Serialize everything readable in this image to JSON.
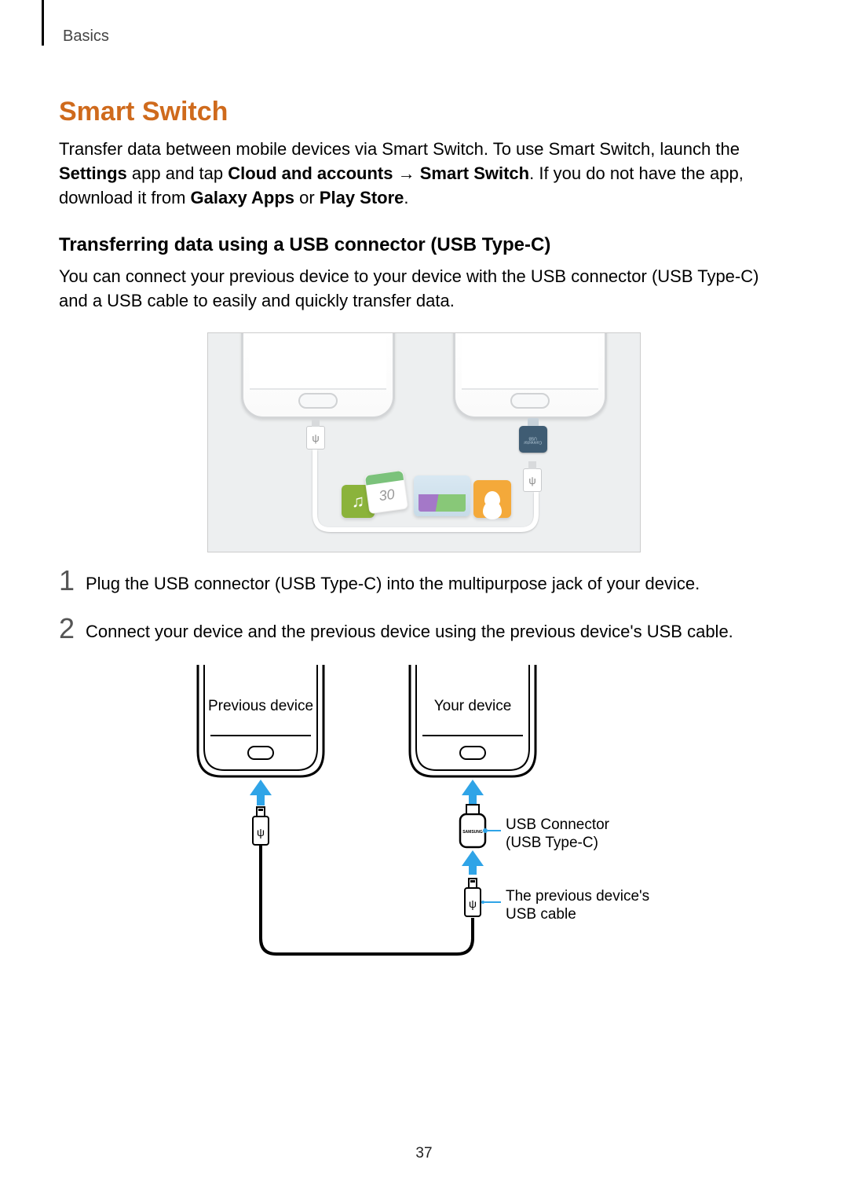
{
  "breadcrumb": "Basics",
  "title": "Smart Switch",
  "intro": {
    "p1a": "Transfer data between mobile devices via Smart Switch. To use Smart Switch, launch the ",
    "b1": "Settings",
    "p1b": " app and tap ",
    "b2": "Cloud and accounts",
    "arrow": " → ",
    "b3": "Smart Switch",
    "p1c": ". If you do not have the app, download it from ",
    "b4": "Galaxy Apps",
    "p1d": " or ",
    "b5": "Play Store",
    "p1e": "."
  },
  "subtitle": "Transferring data using a USB connector (USB Type-C)",
  "subintro": "You can connect your previous device to your device with the USB connector (USB Type-C) and a USB cable to easily and quickly transfer data.",
  "fig1": {
    "adapter_label_line1": "Connector",
    "adapter_label_line2": "USB",
    "cal_num": "30"
  },
  "steps": [
    {
      "num": "1",
      "text": "Plug the USB connector (USB Type-C) into the multipurpose jack of your device."
    },
    {
      "num": "2",
      "text": "Connect your device and the previous device using the previous device's USB cable."
    }
  ],
  "fig2": {
    "prev_device": "Previous device",
    "your_device": "Your device",
    "label_connector_l1": "USB Connector",
    "label_connector_l2": "(USB Type-C)",
    "label_cable_l1": "The previous device's",
    "label_cable_l2": "USB cable",
    "samsung": "SAMSUNG"
  },
  "page_number": "37"
}
